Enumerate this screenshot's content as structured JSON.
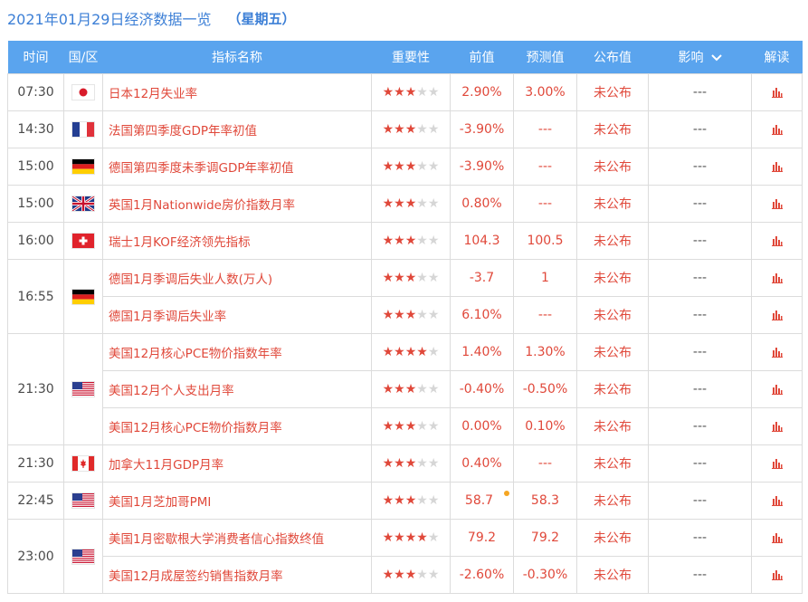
{
  "header": {
    "date": "2021年01月29日经济数据一览",
    "weekday": "（星期五）"
  },
  "columns": {
    "time": "时间",
    "country": "国/区",
    "name": "指标名称",
    "importance": "重要性",
    "prev": "前值",
    "forecast": "预测值",
    "actual": "公布值",
    "impact": "影响",
    "interpret": "解读"
  },
  "colors": {
    "header_bg": "#5aa4ee",
    "accent_red": "#e0483a",
    "title_blue": "#3c7fd6"
  },
  "groups": [
    {
      "time": "07:30",
      "flag": "japan-flag",
      "rows": [
        {
          "name": "日本12月失业率",
          "stars": 3,
          "prev": "2.90%",
          "forecast": "3.00%",
          "actual": "未公布",
          "impact": "---"
        }
      ]
    },
    {
      "time": "14:30",
      "flag": "france-flag",
      "rows": [
        {
          "name": "法国第四季度GDP年率初值",
          "stars": 3,
          "prev": "-3.90%",
          "forecast": "---",
          "actual": "未公布",
          "impact": "---"
        }
      ]
    },
    {
      "time": "15:00",
      "flag": "germany-flag",
      "rows": [
        {
          "name": "德国第四季度未季调GDP年率初值",
          "stars": 3,
          "prev": "-3.90%",
          "forecast": "---",
          "actual": "未公布",
          "impact": "---"
        }
      ]
    },
    {
      "time": "15:00",
      "flag": "uk-flag",
      "rows": [
        {
          "name": "英国1月Nationwide房价指数月率",
          "stars": 3,
          "prev": "0.80%",
          "forecast": "---",
          "actual": "未公布",
          "impact": "---"
        }
      ]
    },
    {
      "time": "16:00",
      "flag": "switzerland-flag",
      "rows": [
        {
          "name": "瑞士1月KOF经济领先指标",
          "stars": 3,
          "prev": "104.3",
          "forecast": "100.5",
          "actual": "未公布",
          "impact": "---"
        }
      ]
    },
    {
      "time": "16:55",
      "flag": "germany-flag",
      "rows": [
        {
          "name": "德国1月季调后失业人数(万人)",
          "stars": 3,
          "prev": "-3.7",
          "forecast": "1",
          "actual": "未公布",
          "impact": "---"
        },
        {
          "name": "德国1月季调后失业率",
          "stars": 3,
          "prev": "6.10%",
          "forecast": "---",
          "actual": "未公布",
          "impact": "---"
        }
      ]
    },
    {
      "time": "21:30",
      "flag": "usa-flag",
      "rows": [
        {
          "name": "美国12月核心PCE物价指数年率",
          "stars": 4,
          "prev": "1.40%",
          "forecast": "1.30%",
          "actual": "未公布",
          "impact": "---"
        },
        {
          "name": "美国12月个人支出月率",
          "stars": 3,
          "prev": "-0.40%",
          "forecast": "-0.50%",
          "actual": "未公布",
          "impact": "---"
        },
        {
          "name": "美国12月核心PCE物价指数月率",
          "stars": 3,
          "prev": "0.00%",
          "forecast": "0.10%",
          "actual": "未公布",
          "impact": "---"
        }
      ]
    },
    {
      "time": "21:30",
      "flag": "canada-flag",
      "rows": [
        {
          "name": "加拿大11月GDP月率",
          "stars": 3,
          "prev": "0.40%",
          "forecast": "---",
          "actual": "未公布",
          "impact": "---"
        }
      ]
    },
    {
      "time": "22:45",
      "flag": "usa-flag",
      "rows": [
        {
          "name": "美国1月芝加哥PMI",
          "stars": 3,
          "prev": "58.7",
          "forecast": "58.3",
          "actual": "未公布",
          "impact": "---",
          "revised_dot": true
        }
      ]
    },
    {
      "time": "23:00",
      "flag": "usa-flag",
      "rows": [
        {
          "name": "美国1月密歇根大学消费者信心指数终值",
          "stars": 4,
          "prev": "79.2",
          "forecast": "79.2",
          "actual": "未公布",
          "impact": "---"
        },
        {
          "name": "美国12月成屋签约销售指数月率",
          "stars": 3,
          "prev": "-2.60%",
          "forecast": "-0.30%",
          "actual": "未公布",
          "impact": "---"
        }
      ]
    }
  ]
}
